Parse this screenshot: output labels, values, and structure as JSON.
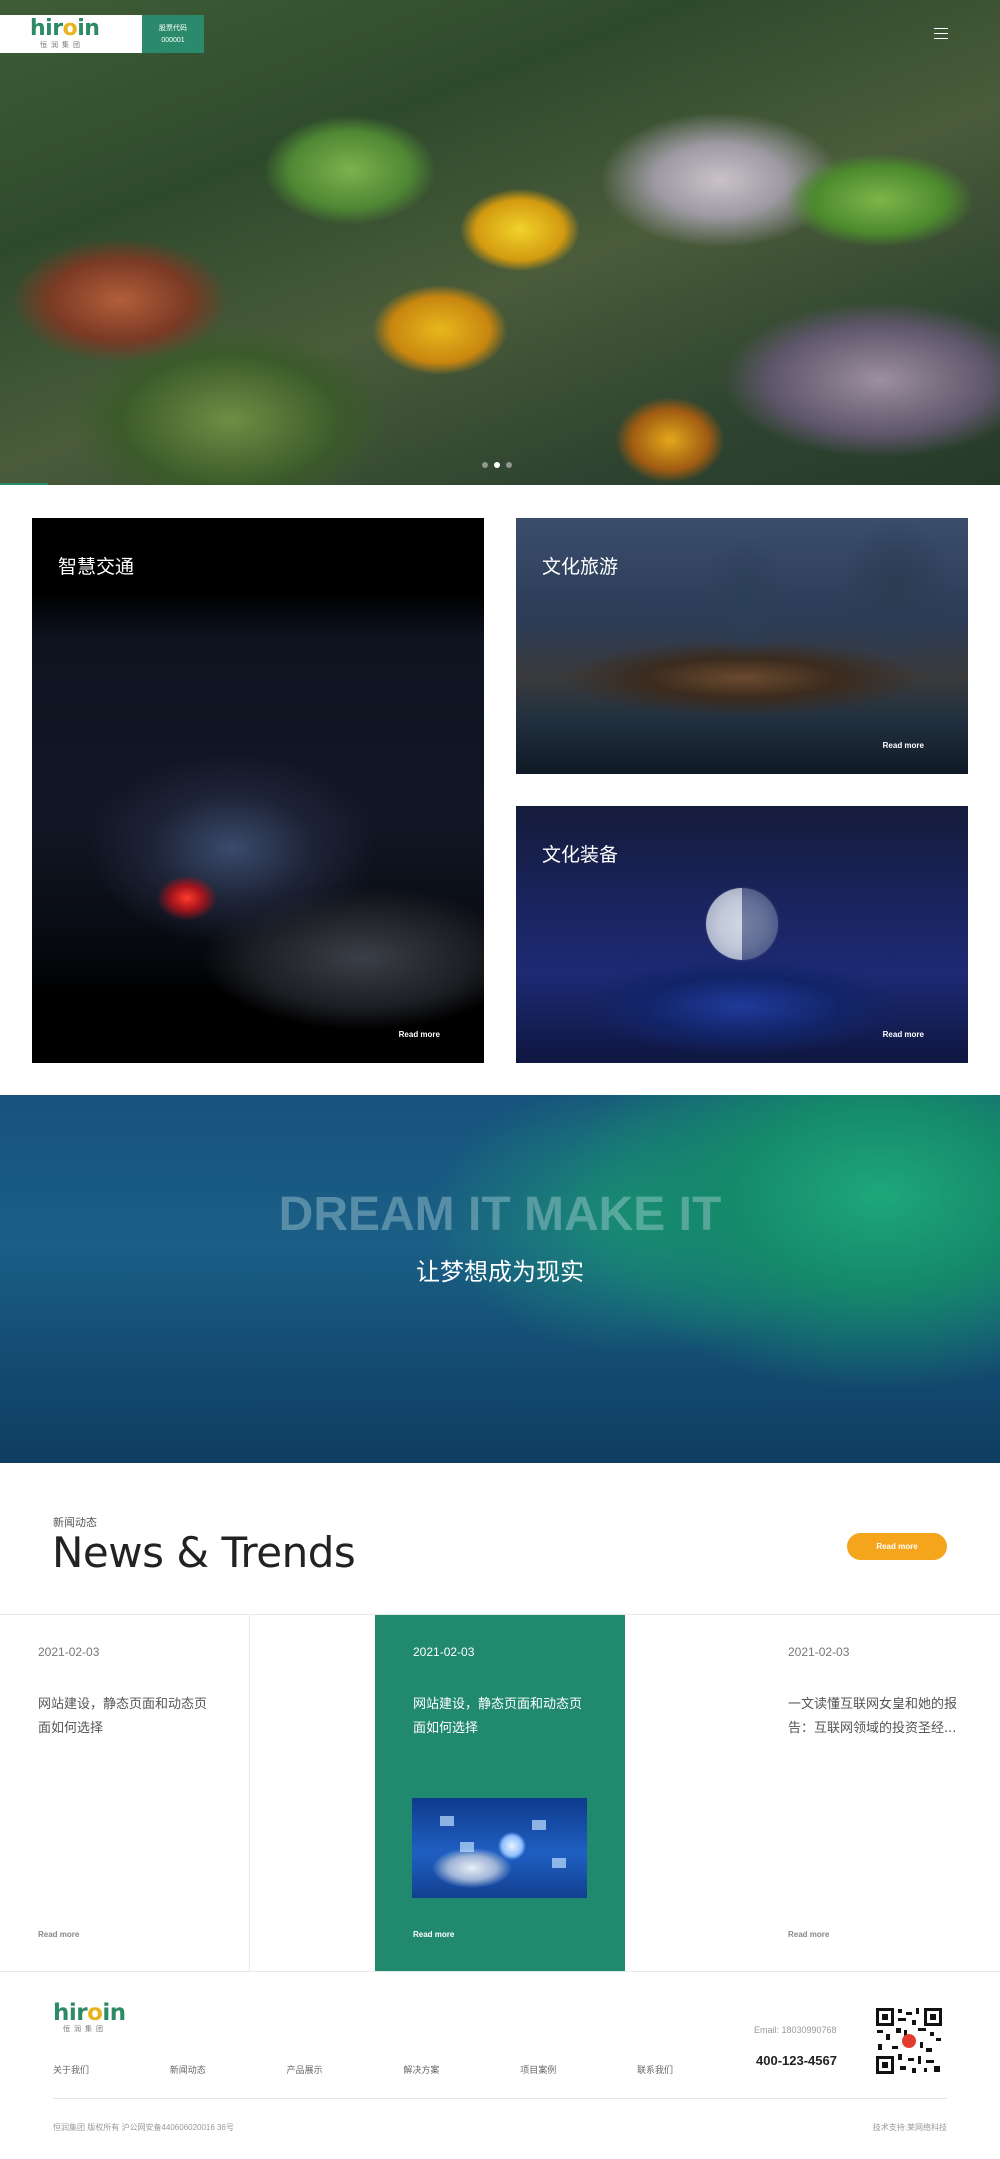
{
  "header": {
    "logo_text_main": "hir",
    "logo_text_dot": "o",
    "logo_text_end": "in",
    "logo_sub": "恒润集团",
    "stock_label": "股票代码",
    "stock_code": "000001"
  },
  "hero": {
    "slide_count": 3,
    "active_slide": 2
  },
  "cards": [
    {
      "title": "智慧交通",
      "more": "Read more"
    },
    {
      "title": "文化旅游",
      "more": "Read more"
    },
    {
      "title": "文化装备",
      "more": "Read more"
    }
  ],
  "dream": {
    "en": "DREAM IT MAKE IT",
    "cn": "让梦想成为现实"
  },
  "news": {
    "subtitle": "新闻动态",
    "title": "News & Trends",
    "more_button": "Read more",
    "items": [
      {
        "date": "2021-02-03",
        "text": "网站建设，静态页面和动态页面如何选择",
        "more": "Read more"
      },
      {
        "date": "2021-02-03",
        "text": "网站建设，静态页面和动态页面如何选择",
        "more": "Read more"
      },
      {
        "date": "2021-02-03",
        "text": "一文读懂互联网女皇和她的报告：互联网领域的投资圣经...",
        "more": "Read more"
      }
    ]
  },
  "footer": {
    "logo_text_main": "hir",
    "logo_text_dot": "o",
    "logo_text_end": "in",
    "logo_sub": "恒润集团",
    "email": "Email: 18030990768",
    "phone": "400-123-4567",
    "nav": [
      "关于我们",
      "新闻动态",
      "产品展示",
      "解决方案",
      "项目案例",
      "联系我们"
    ],
    "copyright": "恒润集团 版权所有   沪公网安备440606020016 36号",
    "tech": "技术支持:莱网络科技"
  },
  "colors": {
    "brand_green": "#2a8a6b",
    "accent_yellow": "#f4a51c"
  }
}
